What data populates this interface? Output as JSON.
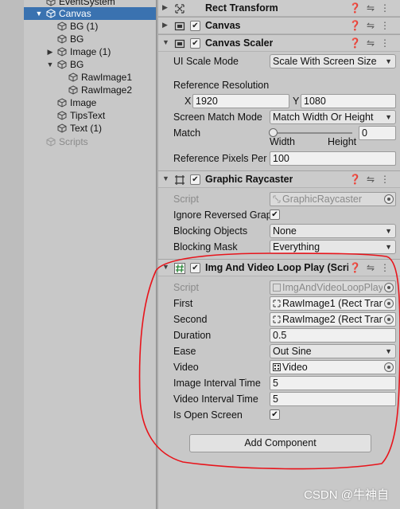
{
  "hierarchy": {
    "items": [
      {
        "label": "EventSystem"
      },
      {
        "label": "Canvas"
      },
      {
        "label": "BG (1)"
      },
      {
        "label": "BG"
      },
      {
        "label": "Image (1)"
      },
      {
        "label": "BG"
      },
      {
        "label": "RawImage1"
      },
      {
        "label": "RawImage2"
      },
      {
        "label": "Image"
      },
      {
        "label": "TipsText"
      },
      {
        "label": "Text (1)"
      },
      {
        "label": "Scripts"
      }
    ]
  },
  "inspector": {
    "rect_transform": {
      "title": "Rect Transform"
    },
    "canvas": {
      "title": "Canvas"
    },
    "canvas_scaler": {
      "title": "Canvas Scaler",
      "ui_scale_mode_label": "UI Scale Mode",
      "ui_scale_mode_value": "Scale With Screen Size",
      "ref_res_label": "Reference Resolution",
      "x_label": "X",
      "x_value": "1920",
      "y_label": "Y",
      "y_value": "1080",
      "match_mode_label": "Screen Match Mode",
      "match_mode_value": "Match Width Or Height",
      "match_label": "Match",
      "match_value": "0",
      "match_slider_level": 0,
      "width_label": "Width",
      "height_label": "Height",
      "ref_ppu_label": "Reference Pixels Per",
      "ref_ppu_value": "100"
    },
    "graphic_raycaster": {
      "title": "Graphic Raycaster",
      "script_label": "Script",
      "script_value": "GraphicRaycaster",
      "ignore_label": "Ignore Reversed Grap",
      "blocking_objects_label": "Blocking Objects",
      "blocking_objects_value": "None",
      "blocking_mask_label": "Blocking Mask",
      "blocking_mask_value": "Everything"
    },
    "loop_play": {
      "title": "Img And Video Loop Play (Scrip",
      "script_label": "Script",
      "script_value": "ImgAndVideoLoopPlay",
      "first_label": "First",
      "first_value": "RawImage1 (Rect Tran",
      "second_label": "Second",
      "second_value": "RawImage2 (Rect Tran",
      "duration_label": "Duration",
      "duration_value": "0.5",
      "ease_label": "Ease",
      "ease_value": "Out Sine",
      "video_label": "Video",
      "video_value": "Video",
      "img_interval_label": "Image Interval Time",
      "img_interval_value": "5",
      "video_interval_label": "Video Interval Time",
      "video_interval_value": "5",
      "open_screen_label": "Is Open Screen"
    },
    "add_component_label": "Add Component"
  },
  "watermark": "CSDN @牛神自",
  "colors": {
    "selection": "#3a72b0",
    "annotation": "#e8141b"
  }
}
